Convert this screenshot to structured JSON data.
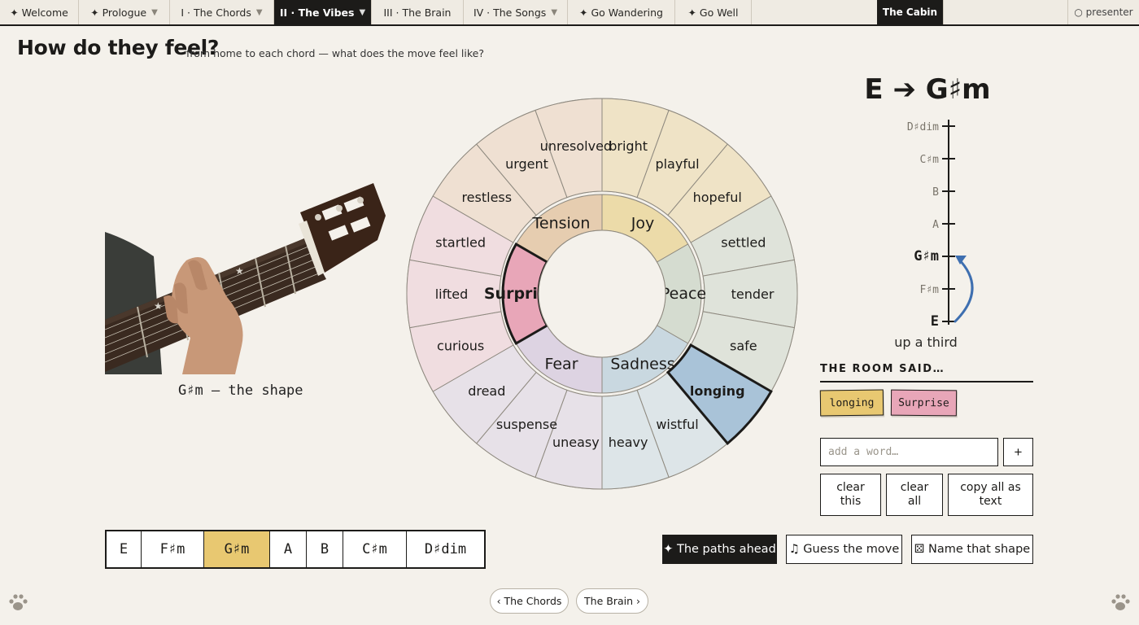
{
  "nav": {
    "tabs": [
      {
        "label": "✦ Welcome",
        "caret": ""
      },
      {
        "label": "✦ Prologue",
        "caret": "▼"
      },
      {
        "label": "I · The Chords",
        "caret": "▼"
      },
      {
        "label": "II · The Vibes",
        "caret": "▼"
      },
      {
        "label": "III · The Brain",
        "caret": ""
      },
      {
        "label": "IV · The Songs",
        "caret": "▼"
      },
      {
        "label": "✦ Go Wandering",
        "caret": ""
      },
      {
        "label": "✦ Go Well",
        "caret": ""
      }
    ],
    "active_tab": "II · The Vibes",
    "cabin": "The Cabin",
    "presenter": "○ presenter"
  },
  "page": {
    "title": "How do they feel?",
    "subtitle": "from home to each chord — what does the move feel like?"
  },
  "guitar": {
    "caption": "G♯m — the shape"
  },
  "wheel": {
    "inner": [
      "Joy",
      "Peace",
      "Sadness",
      "Fear",
      "Surprise",
      "Tension"
    ],
    "inner_colors": [
      "#ecdba9",
      "#d5dcd0",
      "#c9d8e0",
      "#ddd3e2",
      "#e8a6b8",
      "#e6cdb0"
    ],
    "outer": [
      "bright",
      "playful",
      "hopeful",
      "settled",
      "tender",
      "safe",
      "longing",
      "wistful",
      "heavy",
      "uneasy",
      "suspense",
      "dread",
      "curious",
      "lifted",
      "startled",
      "restless",
      "urgent",
      "unresolved"
    ],
    "outer_colors": [
      "#efe3c6",
      "#efe3c6",
      "#efe3c6",
      "#dfe3da",
      "#dfe3da",
      "#dfe3da",
      "#a9c3d8",
      "#dde5e8",
      "#dde5e8",
      "#e7e1e8",
      "#e7e1e8",
      "#e7e1e8",
      "#f0dde0",
      "#f0dde0",
      "#f0dde0",
      "#efe0d2",
      "#efe0d2",
      "#efe0d2"
    ],
    "selected": [
      "Surprise",
      "longing"
    ]
  },
  "move": {
    "title": "E ➔ G♯m",
    "ladder": [
      "D♯dim",
      "C♯m",
      "B",
      "A",
      "G♯m",
      "F♯m",
      "E"
    ],
    "from": "E",
    "to": "G♯m",
    "description": "up a third"
  },
  "room": {
    "heading": "THE ROOM SAID…",
    "tags": [
      {
        "label": "longing",
        "color": "#e8c871"
      },
      {
        "label": "Surprise",
        "color": "#e8a6b8"
      }
    ],
    "input_placeholder": "add a word…",
    "add_label": "+",
    "clear_this": "clear this",
    "clear_all": "clear all",
    "copy_all": "copy all as text"
  },
  "chords": {
    "items": [
      "E",
      "F♯m",
      "G♯m",
      "A",
      "B",
      "C♯m",
      "D♯dim"
    ],
    "selected": "G♯m"
  },
  "actions": {
    "paths": "✦ The paths ahead",
    "guess": "♫ Guess the move",
    "name": "⚄ Name that shape"
  },
  "footer": {
    "prev": "‹ The Chords",
    "next": "The Brain ›"
  },
  "colors": {
    "ink": "#1c1b19",
    "paper": "#f4f1eb",
    "highlight": "#e8c871",
    "arrow": "#3e6fb0"
  }
}
